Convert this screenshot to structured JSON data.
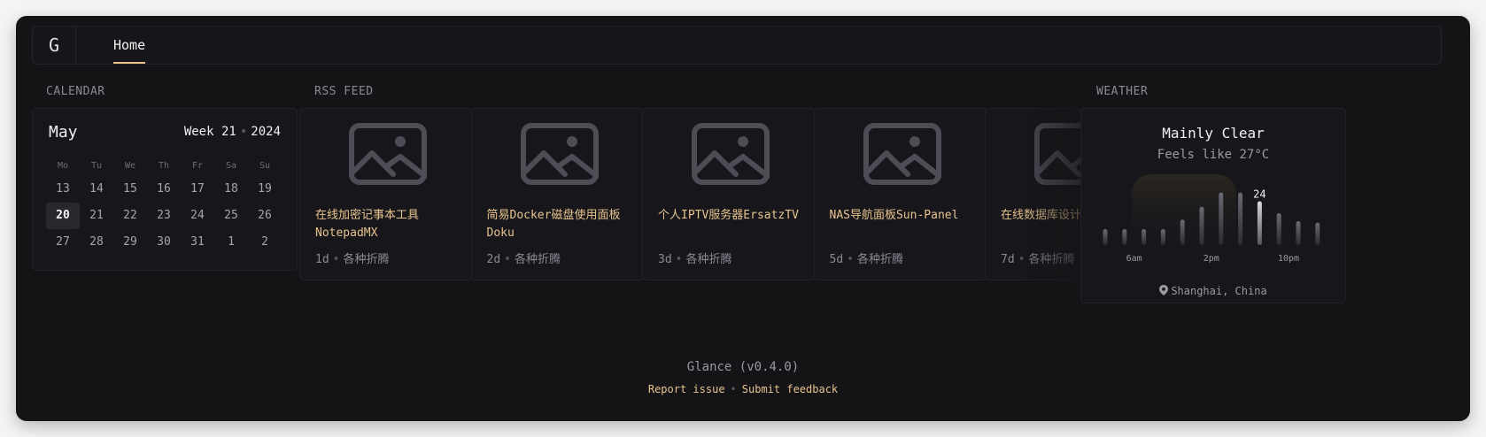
{
  "nav": {
    "logo": "G",
    "tabs": [
      {
        "label": "Home",
        "active": true
      }
    ]
  },
  "calendar": {
    "section_title": "CALENDAR",
    "month": "May",
    "week_label": "Week 21",
    "year": "2024",
    "weekdays": [
      "Mo",
      "Tu",
      "We",
      "Th",
      "Fr",
      "Sa",
      "Su"
    ],
    "days": [
      "13",
      "14",
      "15",
      "16",
      "17",
      "18",
      "19",
      "20",
      "21",
      "22",
      "23",
      "24",
      "25",
      "26",
      "27",
      "28",
      "29",
      "30",
      "31",
      "1",
      "2"
    ],
    "today": "20"
  },
  "rss": {
    "section_title": "RSS FEED",
    "items": [
      {
        "title": "在线加密记事本工具NotepadMX",
        "age": "1d",
        "source": "各种折腾"
      },
      {
        "title": "简易Docker磁盘使用面板Doku",
        "age": "2d",
        "source": "各种折腾"
      },
      {
        "title": "个人IPTV服务器ErsatzTV",
        "age": "3d",
        "source": "各种折腾"
      },
      {
        "title": "NAS导航面板Sun-Panel",
        "age": "5d",
        "source": "各种折腾"
      },
      {
        "title": "在线数据库设计drawDB",
        "age": "7d",
        "source": "各种折腾"
      }
    ]
  },
  "weather": {
    "section_title": "WEATHER",
    "condition": "Mainly Clear",
    "feels_like": "Feels like 27°C",
    "current_temp": "24",
    "current_index": 8,
    "bar_levels": [
      0.2,
      0.2,
      0.2,
      0.2,
      0.32,
      0.48,
      0.66,
      0.66,
      0.55,
      0.4,
      0.3,
      0.28
    ],
    "time_labels": [
      "6am",
      "2pm",
      "10pm"
    ],
    "location": "Shanghai, China"
  },
  "footer": {
    "version": "Glance (v0.4.0)",
    "report_issue": "Report issue",
    "submit_feedback": "Submit feedback"
  },
  "colors": {
    "background": "#141417",
    "accent": "#e8c48c",
    "muted": "#8a8a94"
  }
}
